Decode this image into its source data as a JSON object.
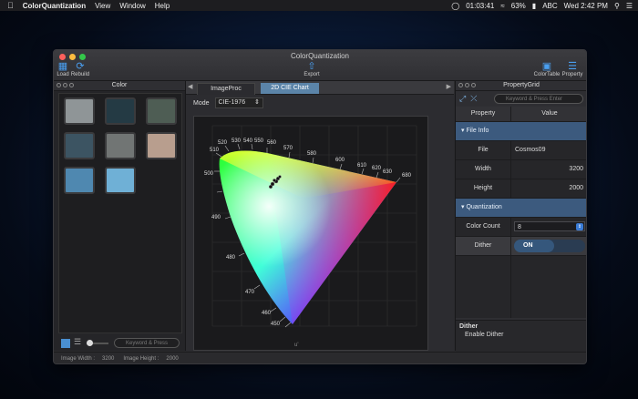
{
  "menubar": {
    "apple": "",
    "app_name": "ColorQuantization",
    "menus": [
      "View",
      "Window",
      "Help"
    ],
    "timer": "01:03:41",
    "battery": "63%",
    "input": "ABC",
    "clock": "Wed 2:42 PM"
  },
  "window": {
    "title": "ColorQuantization",
    "toolbar": {
      "load": "Load",
      "rebuild": "Rebuild",
      "export": "Export",
      "colortable": "ColorTable",
      "property": "Property"
    }
  },
  "color_panel": {
    "title": "Color",
    "swatches": [
      "#8f9597",
      "#243a44",
      "#4e5d54",
      "#3c5462",
      "#717574",
      "#b89e8e",
      "#4f88b0",
      "#6fb0d6"
    ],
    "search_placeholder": "Keyword & Press"
  },
  "center": {
    "tabs": [
      "ImageProc",
      "2D CIE Chart"
    ],
    "mode_label": "Mode",
    "mode_value": "CIE-1976",
    "wavelengths": [
      "450",
      "460",
      "470",
      "480",
      "490",
      "500",
      "510",
      "520",
      "530",
      "540",
      "550",
      "560",
      "570",
      "580",
      "590",
      "600",
      "610",
      "620",
      "630",
      "680"
    ],
    "axis_label": "u'"
  },
  "property_grid": {
    "title": "PropertyGrid",
    "search_placeholder": "Keyword & Press Enter",
    "col_property": "Property",
    "col_value": "Value",
    "cat_fileinfo": "File Info",
    "file_label": "File",
    "file_value": "Cosmos09",
    "width_label": "Width",
    "width_value": "3200",
    "height_label": "Height",
    "height_value": "2000",
    "cat_quant": "Quantization",
    "colorcount_label": "Color Count",
    "colorcount_value": "8",
    "dither_label": "Dither",
    "dither_value": "ON",
    "desc_title": "Dither",
    "desc_text": "Enable Dither"
  },
  "status": {
    "width_label": "Image Width :",
    "width_value": "3200",
    "height_label": "Image Height :",
    "height_value": "2000"
  },
  "colors": {
    "accent": "#3c5a7e",
    "tab_active": "#5b84a8"
  }
}
